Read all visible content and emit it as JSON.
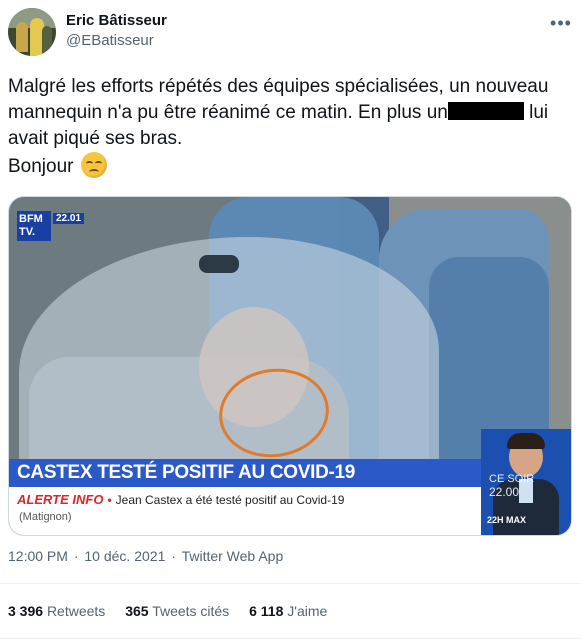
{
  "author": {
    "name": "Eric Bâtisseur",
    "handle": "@EBatisseur",
    "avatar_icon": "avatar-photo"
  },
  "more_icon": "more-horizontal-icon",
  "tweet": {
    "line1": "Malgré les efforts répétés des équipes spécialisées, un nouveau mannequin n'a pu être réanimé ce matin. En plus un",
    "line2": "lui avait piqué ses bras.",
    "line3": "Bonjour",
    "emoji": "unamused-face-emoji"
  },
  "media": {
    "channel_logo": "BFM TV.",
    "channel_time": "22.01",
    "headline": "CASTEX TESTÉ POSITIF AU COVID-19",
    "alert_label": "ALERTE INFO",
    "alert_text": "Jean Castex a été testé positif au Covid-19",
    "location": "(Matignon)",
    "show_name": "CE SOIR",
    "show_time": "22.00",
    "show_brand": "22H MAX",
    "annotation_color": "#e07b2e"
  },
  "meta": {
    "time": "12:00 PM",
    "date": "10 déc. 2021",
    "separator": "·",
    "source": "Twitter Web App"
  },
  "stats": {
    "retweets_count": "3 396",
    "retweets_label": "Retweets",
    "quotes_count": "365",
    "quotes_label": "Tweets cités",
    "likes_count": "6 118",
    "likes_label": "J'aime"
  },
  "colors": {
    "text": "#0f1419",
    "secondary": "#536471",
    "headline_bg": "#2b59c7",
    "alert_red": "#d62a2a"
  }
}
